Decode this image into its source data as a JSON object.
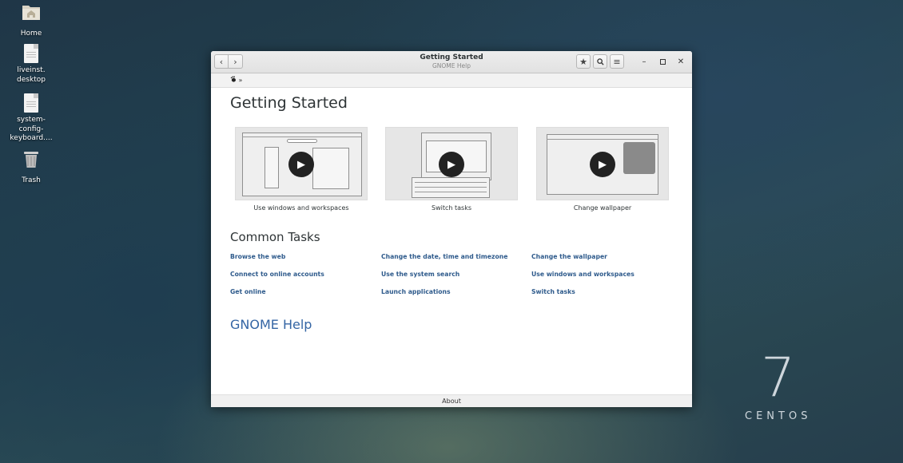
{
  "desktop": {
    "icons": [
      {
        "label": "Home",
        "icon": "folder-home-icon"
      },
      {
        "label": "liveinst.\ndesktop",
        "icon": "document-icon"
      },
      {
        "label": "system-\nconfig-\nkeyboard....",
        "icon": "document-icon"
      },
      {
        "label": "Trash",
        "icon": "trash-icon"
      }
    ],
    "logo_number": "7",
    "logo_text": "CENTOS"
  },
  "window": {
    "title": "Getting Started",
    "subtitle": "GNOME Help",
    "breadcrumb_sep": "»",
    "footer": "About"
  },
  "page": {
    "heading": "Getting Started",
    "videos": [
      {
        "label": "Use windows and workspaces"
      },
      {
        "label": "Switch tasks"
      },
      {
        "label": "Change wallpaper"
      }
    ],
    "common_heading": "Common Tasks",
    "tasks": [
      [
        "Browse the web",
        "Change the date, time and timezone",
        "Change the wallpaper"
      ],
      [
        "Connect to online accounts",
        "Use the system search",
        "Use windows and workspaces"
      ],
      [
        "Get online",
        "Launch applications",
        "Switch tasks"
      ]
    ],
    "more_link": "GNOME Help"
  },
  "colors": {
    "link": "#2f5b8c",
    "heading_link": "#3465a4"
  }
}
